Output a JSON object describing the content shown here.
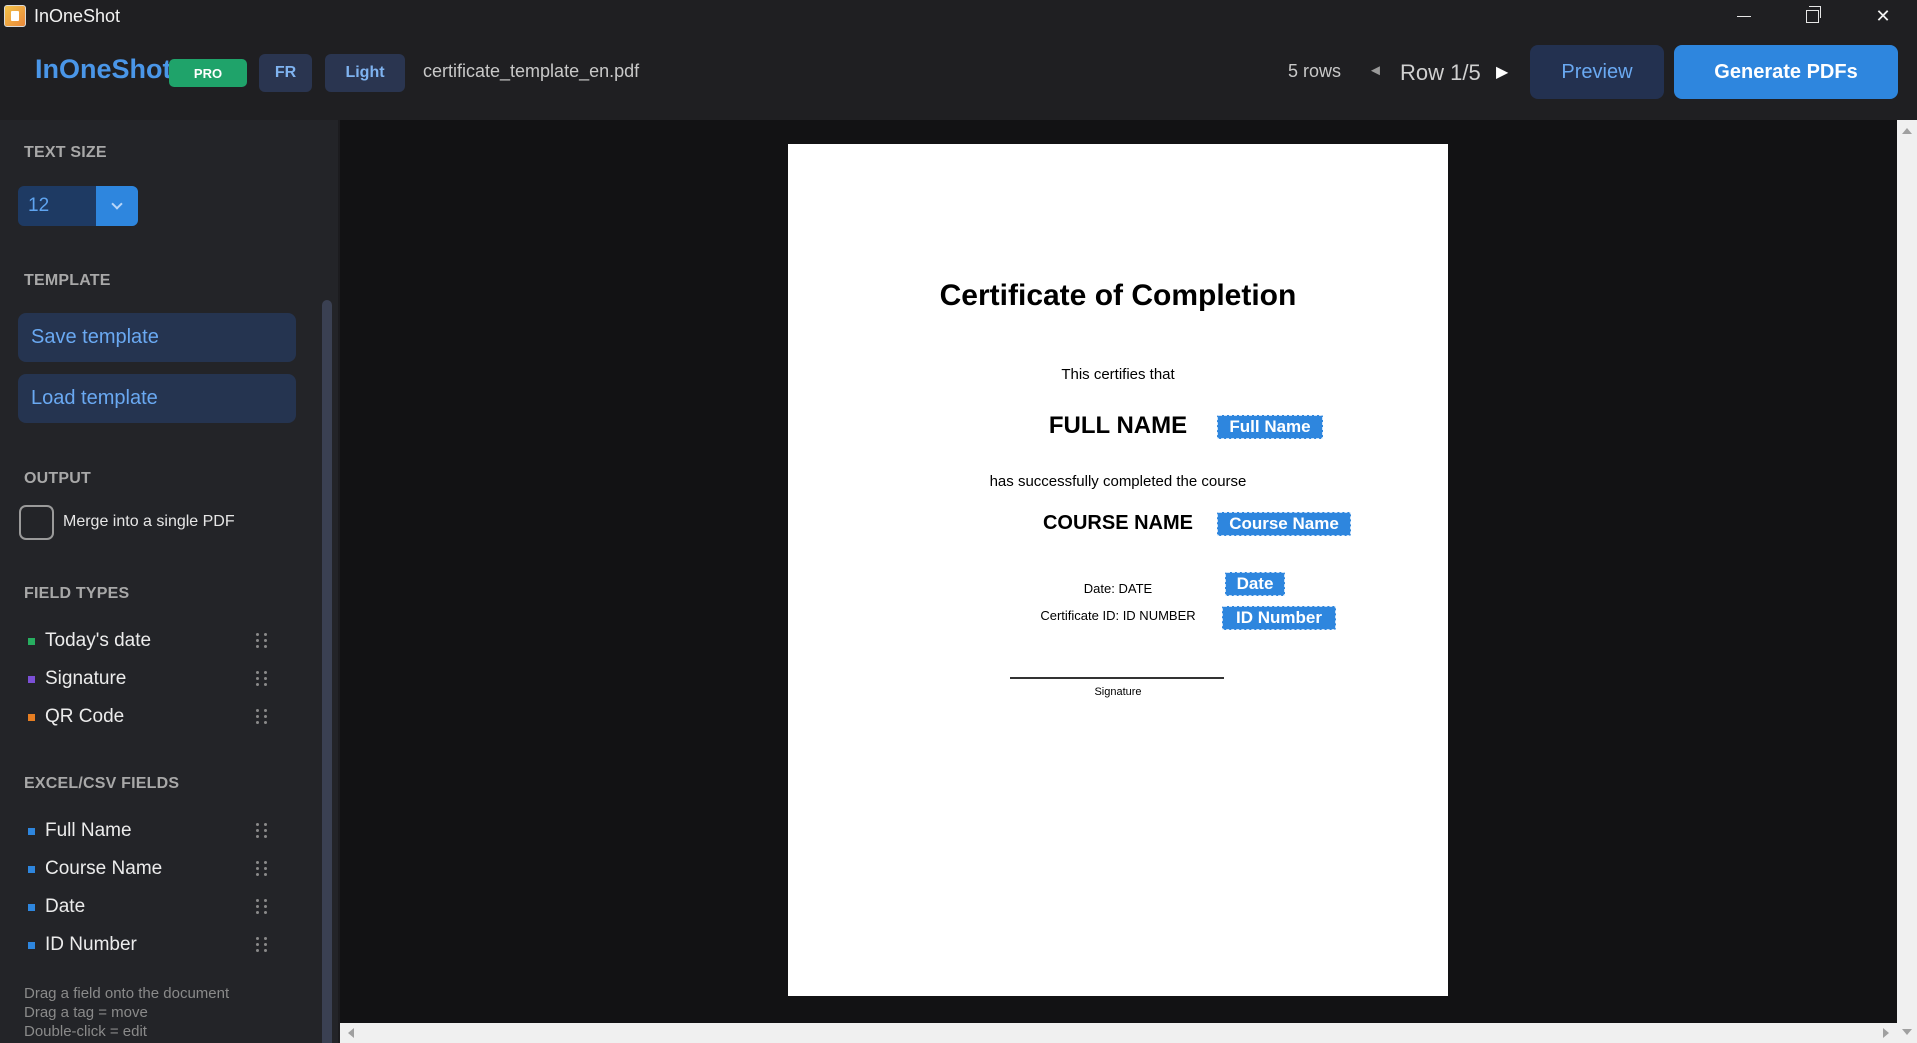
{
  "window": {
    "title": "InOneShot",
    "icons": {
      "app": "app-icon",
      "minimize": "minimize-icon",
      "maximize": "restore-icon",
      "close": "close-icon"
    },
    "close_glyph": "✕"
  },
  "header": {
    "brand": "InOneShot",
    "badge": "PRO",
    "language_button": "FR",
    "theme_button": "Light",
    "filename": "certificate_template_en.pdf",
    "rows_count": "5 rows",
    "prev_glyph": "◄",
    "next_glyph": "▶",
    "row_indicator": "Row 1/5",
    "preview_button": "Preview",
    "generate_button": "Generate PDFs"
  },
  "sidebar": {
    "text_size": {
      "heading": "TEXT SIZE",
      "value": "12"
    },
    "template": {
      "heading": "TEMPLATE",
      "save_label": "Save template",
      "load_label": "Load template"
    },
    "output": {
      "heading": "OUTPUT",
      "merge_label": "Merge into a single PDF",
      "merge_checked": false
    },
    "field_types": {
      "heading": "FIELD TYPES",
      "items": [
        {
          "label": "Today's date",
          "color": "#27ae60"
        },
        {
          "label": "Signature",
          "color": "#7b4fd6"
        },
        {
          "label": "QR Code",
          "color": "#e67e22"
        }
      ]
    },
    "excel_fields": {
      "heading": "EXCEL/CSV FIELDS",
      "items": [
        {
          "label": "Full Name",
          "color": "#2e86de"
        },
        {
          "label": "Course Name",
          "color": "#2e86de"
        },
        {
          "label": "Date",
          "color": "#2e86de"
        },
        {
          "label": "ID Number",
          "color": "#2e86de"
        }
      ]
    },
    "help": [
      "Drag a field onto the document",
      "Drag a tag = move",
      "Double-click = edit"
    ]
  },
  "document": {
    "title": "Certificate of Completion",
    "certifies": "This certifies that",
    "full_name": "FULL NAME",
    "full_name_tag": "Full Name",
    "completed": "has successfully completed the course",
    "course_name": "COURSE NAME",
    "course_name_tag": "Course Name",
    "date_line": "Date: DATE",
    "date_tag": "Date",
    "id_line": "Certificate ID: ID NUMBER",
    "id_tag": "ID Number",
    "signature_label": "Signature"
  },
  "colors": {
    "accent": "#2e86de",
    "pro_badge": "#1fa36a",
    "background": "#121214",
    "sidebar": "#232428"
  }
}
